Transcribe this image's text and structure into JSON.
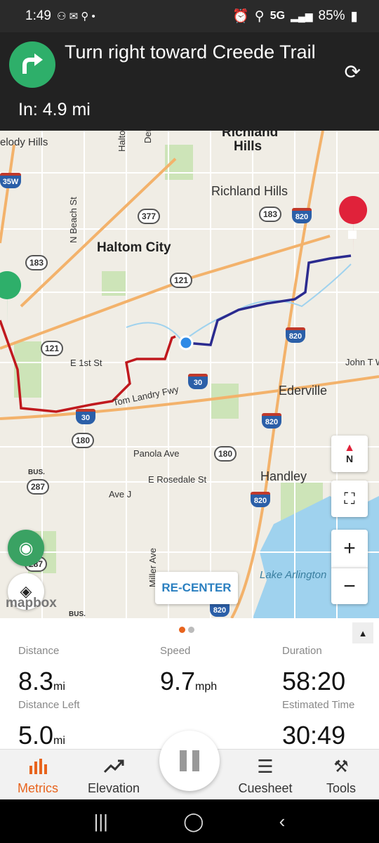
{
  "status_bar": {
    "time": "1:49",
    "network": "5G",
    "battery": "85%"
  },
  "nav": {
    "instruction": "Turn right toward Creede Trail",
    "distance": "In: 4.9 mi",
    "turn_color": "#2eaf6a"
  },
  "map": {
    "cities": [
      "Richland Hills",
      "Haltom City"
    ],
    "towns": [
      "Richland Hills",
      "Ederville",
      "Handley"
    ],
    "partial_town": "Hills",
    "partial_town_top": "Richland",
    "streets": [
      "elody Hills",
      "Haltom Rd",
      "Denton Hwy",
      "N Beach St",
      "E 1st St",
      "Tom Landry Fwy",
      "Panola Ave",
      "E Rosedale St",
      "Ave J",
      "Miller Ave",
      "John T W"
    ],
    "water": "Lake Arlington",
    "shields": {
      "s377": "377",
      "s183a": "183",
      "s183b": "183",
      "s121a": "121",
      "s121b": "121",
      "s180a": "180",
      "s180b": "180",
      "s287a": "287",
      "s287b": "287"
    },
    "interstates": {
      "i820a": "820",
      "i820b": "820",
      "i820c": "820",
      "i820d": "820",
      "i820e": "820",
      "i30a": "30",
      "i30b": "30",
      "i35w": "35W"
    },
    "bus_label": "BUS.",
    "bus_label2": "BUS.",
    "compass_label": "N",
    "recenter_label": "RE-CENTER",
    "attribution": "mapbox",
    "route_done_color": "#c0191e",
    "route_remaining_color": "#2b2b8f"
  },
  "metrics": {
    "distance": {
      "label": "Distance",
      "value": "8.3",
      "unit": "mi"
    },
    "speed": {
      "label": "Speed",
      "value": "9.7",
      "unit": "mph"
    },
    "duration": {
      "label": "Duration",
      "value": "58:20"
    },
    "distance_left": {
      "label": "Distance Left",
      "value": "5.0",
      "unit": "mi"
    },
    "estimated_time": {
      "label": "Estimated Time",
      "value": "30:49"
    }
  },
  "tabs": {
    "metrics": "Metrics",
    "elevation": "Elevation",
    "cuesheet": "Cuesheet",
    "tools": "Tools",
    "active_color": "#e8641e"
  }
}
